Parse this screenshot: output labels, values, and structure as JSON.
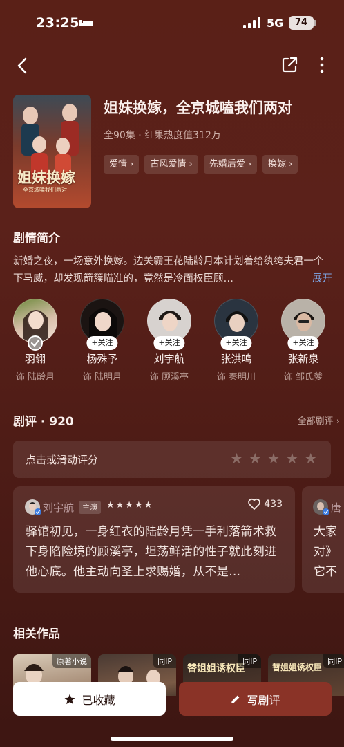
{
  "status_bar": {
    "time": "23:25",
    "network": "5G",
    "battery": "74"
  },
  "drama": {
    "title": "姐妹换嫁，全京城嗑我们两对",
    "meta": "全90集 · 红果热度值312万",
    "poster_text": "姐妹换嫁",
    "poster_subtext": "全京城嗑我们两对",
    "tags": [
      "爱情 ›",
      "古风爱情 ›",
      "先婚后爱 ›",
      "换嫁 ›"
    ]
  },
  "synopsis": {
    "heading": "剧情简介",
    "text": "新婚之夜，一场意外换嫁。边关霸王花陆龄月本计划着给纨绔夫君一个下马威，却发现箭簇瞄准的，竟然是冷面权臣顾…",
    "expand": "展开"
  },
  "cast": [
    {
      "name": "羽翎",
      "role": "饰 陆龄月",
      "followed": true,
      "follow_label": ""
    },
    {
      "name": "杨殊予",
      "role": "饰 陆明月",
      "followed": false,
      "follow_label": "+关注"
    },
    {
      "name": "刘宇航",
      "role": "饰 顾溪亭",
      "followed": false,
      "follow_label": "+关注"
    },
    {
      "name": "张洪鸣",
      "role": "饰 秦明川",
      "followed": false,
      "follow_label": "+关注"
    },
    {
      "name": "张新泉",
      "role": "饰 邹氏爹",
      "followed": false,
      "follow_label": "+关注"
    }
  ],
  "reviews": {
    "heading": "剧评 · 920",
    "all_link": "全部剧评 ›",
    "rate_prompt": "点击或滑动评分",
    "items": [
      {
        "author": "刘宇航",
        "badge": "主演",
        "stars": "★★★★★",
        "likes": "433",
        "text": "驿馆初见，一身红衣的陆龄月凭一手利落箭术救下身陷险境的顾溪亭，坦荡鲜活的性子就此刻进他心底。他主动向圣上求赐婚，从不是…"
      },
      {
        "author": "唐",
        "text_lines": [
          "大家",
          "对》",
          "它不"
        ]
      }
    ]
  },
  "related": {
    "heading": "相关作品",
    "items": [
      {
        "badge": "原著小说",
        "cover_text": ""
      },
      {
        "badge": "同IP",
        "cover_text": ""
      },
      {
        "badge": "同IP",
        "cover_text": "替姐姐诱权臣"
      },
      {
        "badge": "同IP",
        "cover_text": "替姐姐诱权臣"
      }
    ]
  },
  "actions": {
    "favorite": "已收藏",
    "write_review": "写剧评"
  },
  "colors": {
    "background": "#5a2017",
    "accent_button": "#8a3327",
    "link_blue": "#7fa8e8"
  }
}
